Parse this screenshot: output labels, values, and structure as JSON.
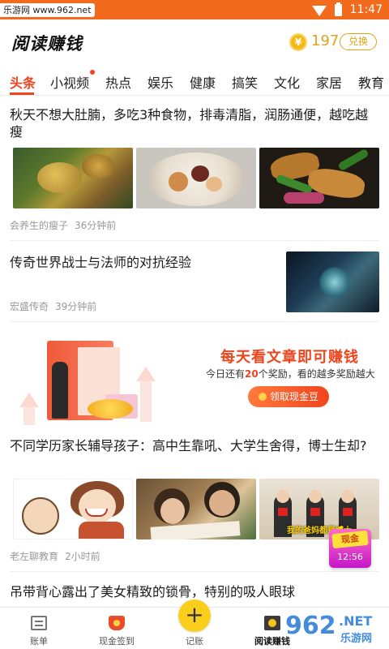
{
  "status_bar": {
    "watermark": "乐游网 www.962.net",
    "time": "11:47"
  },
  "app_bar": {
    "title": "阅读赚钱",
    "coin_symbol": "¥",
    "coin_count": "197",
    "exchange_label": "兑换"
  },
  "tabs": [
    "头条",
    "小视频",
    "热点",
    "娱乐",
    "健康",
    "搞笑",
    "文化",
    "家居",
    "教育"
  ],
  "accent_color": "#f0441d",
  "articles": [
    {
      "title": "秋天不想大肚腩，多吃3种食物，排毒清脂，润肠通便，越吃越瘦",
      "source": "会养生的瘦子",
      "time": "36分钟前"
    },
    {
      "title": "传奇世界战士与法师的对抗经验",
      "source": "宏盛传奇",
      "time": "39分钟前"
    },
    {
      "title": "不同学历家长辅导孩子：高中生靠吼、大学生舍得，博士生却?",
      "source": "老左聊教育",
      "time": "2小时前",
      "image_caption": "我的爸妈都是博士"
    },
    {
      "title": "吊带背心露出了美女精致的锁骨，特别的吸人眼球"
    }
  ],
  "promo": {
    "title": "每天看文章即可赚钱",
    "sub_prefix": "今日还有",
    "sub_count": "20",
    "sub_suffix": "个奖励，看的越多奖励越大",
    "button": "领取现金豆"
  },
  "float_cash": {
    "label": "现金",
    "timer": "12:56"
  },
  "bottom_nav": {
    "items": [
      "账单",
      "现金签到",
      "记账",
      "阅读赚钱"
    ],
    "add_symbol": "+"
  },
  "watermark_bottom": {
    "logo": "962",
    "net": ".NET",
    "sub": "乐游网"
  }
}
